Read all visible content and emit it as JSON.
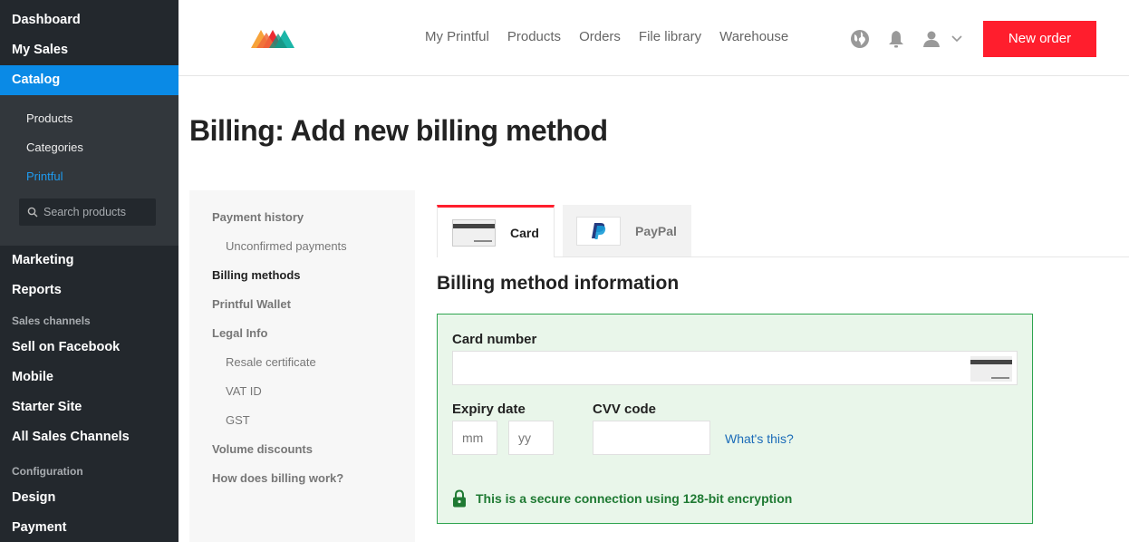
{
  "sidebar": {
    "items_top": [
      "Dashboard",
      "My Sales",
      "Catalog"
    ],
    "active": "Catalog",
    "catalog_sub": [
      "Products",
      "Categories",
      "Printful"
    ],
    "catalog_current": "Printful",
    "search_placeholder": "Search products",
    "items_mid": [
      "Marketing",
      "Reports"
    ],
    "sales_channels_heading": "Sales channels",
    "sales_channels": [
      "Sell on Facebook",
      "Mobile",
      "Starter Site",
      "All Sales Channels"
    ],
    "configuration_heading": "Configuration",
    "configuration": [
      "Design",
      "Payment"
    ]
  },
  "header": {
    "nav": [
      "My Printful",
      "Products",
      "Orders",
      "File library",
      "Warehouse"
    ],
    "new_order_label": "New order"
  },
  "page": {
    "title": "Billing: Add new billing method"
  },
  "billing_nav": [
    {
      "label": "Payment history",
      "sub": false,
      "active": false
    },
    {
      "label": "Unconfirmed payments",
      "sub": true,
      "active": false
    },
    {
      "label": "Billing methods",
      "sub": false,
      "active": true
    },
    {
      "label": "Printful Wallet",
      "sub": false,
      "active": false
    },
    {
      "label": "Legal Info",
      "sub": false,
      "active": false
    },
    {
      "label": "Resale certificate",
      "sub": true,
      "active": false
    },
    {
      "label": "VAT ID",
      "sub": true,
      "active": false
    },
    {
      "label": "GST",
      "sub": true,
      "active": false
    },
    {
      "label": "Volume discounts",
      "sub": false,
      "active": false
    },
    {
      "label": "How does billing work?",
      "sub": false,
      "active": false
    }
  ],
  "tabs": {
    "card_label": "Card",
    "paypal_label": "PayPal",
    "active": "Card"
  },
  "form": {
    "section_title": "Billing method information",
    "card_number_label": "Card number",
    "card_number_value": "",
    "expiry_label": "Expiry date",
    "expiry_month_placeholder": "mm",
    "expiry_year_placeholder": "yy",
    "cvv_label": "CVV code",
    "cvv_value": "",
    "whats_this": "What's this?",
    "secure_text": "This is a secure connection using 128-bit encryption"
  },
  "colors": {
    "sidebar_bg": "#23282d",
    "sidebar_active": "#0a8ae6",
    "accent_red": "#ff1e2d",
    "success_green": "#2ea44f",
    "link_blue": "#1a6bb8"
  }
}
